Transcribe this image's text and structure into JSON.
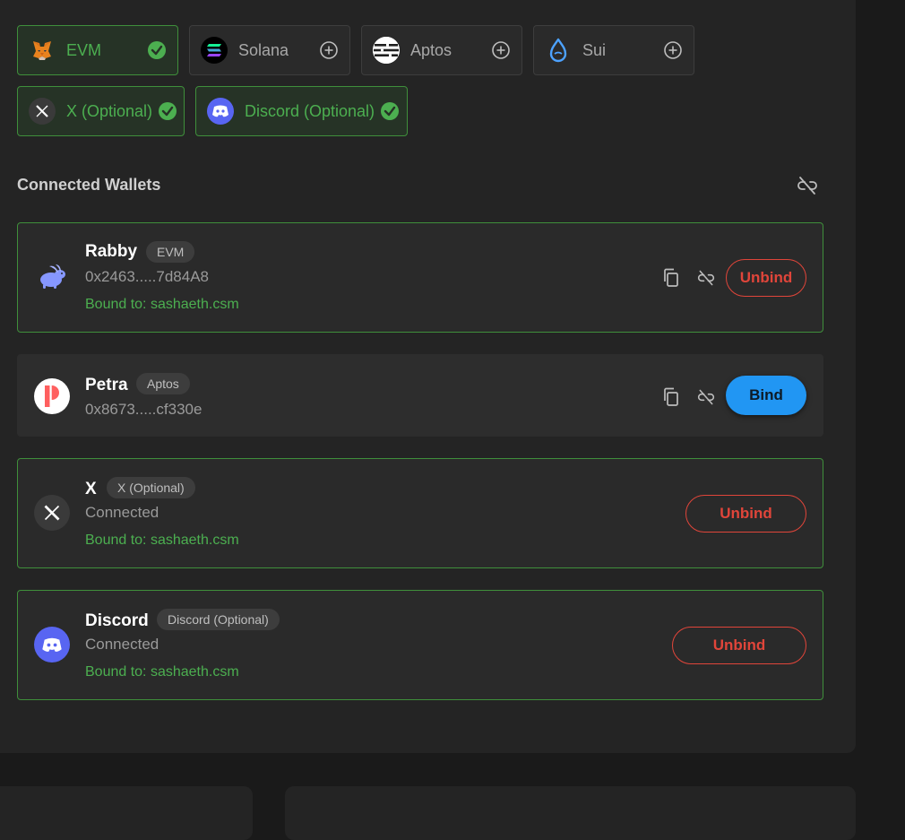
{
  "chains": [
    {
      "label": "EVM",
      "icon": "metamask-fox-icon",
      "status": "connected"
    },
    {
      "label": "Solana",
      "icon": "solana-icon",
      "status": "add"
    },
    {
      "label": "Aptos",
      "icon": "aptos-icon",
      "status": "add"
    },
    {
      "label": "Sui",
      "icon": "sui-drop-icon",
      "status": "add"
    }
  ],
  "socials": [
    {
      "label": "X (Optional)",
      "icon": "x-logo-icon",
      "status": "connected"
    },
    {
      "label": "Discord (Optional)",
      "icon": "discord-icon",
      "status": "connected"
    }
  ],
  "section": {
    "title": "Connected Wallets"
  },
  "wallets": [
    {
      "name": "Rabby",
      "tag": "EVM",
      "address": "0x2463.....7d84A8",
      "bound": "Bound to: sashaeth.csm",
      "action": "Unbind",
      "icon": "rabby-icon"
    },
    {
      "name": "Petra",
      "tag": "Aptos",
      "address": "0x8673.....cf330e",
      "action": "Bind",
      "icon": "petra-icon"
    },
    {
      "name": "X",
      "tag": "X (Optional)",
      "address": "Connected",
      "bound": "Bound to: sashaeth.csm",
      "action": "Unbind",
      "icon": "x-logo-icon"
    },
    {
      "name": "Discord",
      "tag": "Discord (Optional)",
      "address": "Connected",
      "bound": "Bound to: sashaeth.csm",
      "action": "Unbind",
      "icon": "discord-icon"
    }
  ],
  "colors": {
    "accent_green": "#4caf50",
    "danger_red": "#e0453a",
    "bind_blue": "#2196f3",
    "discord_blurple": "#5865f2"
  }
}
